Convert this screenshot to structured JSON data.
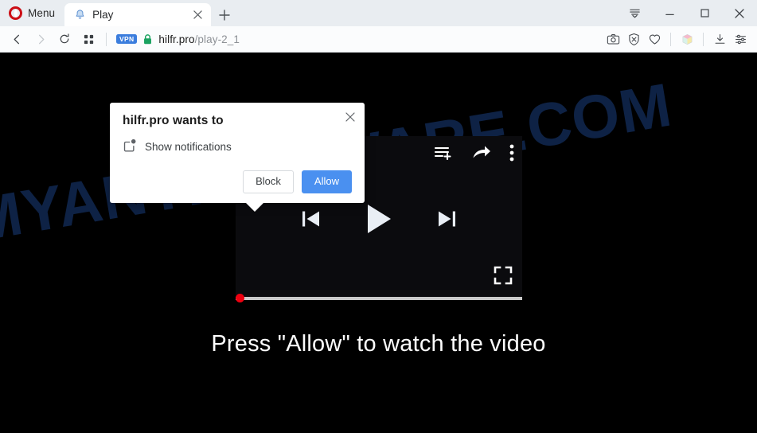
{
  "browser": {
    "menu_label": "Menu",
    "tab": {
      "title": "Play",
      "favicon": "bell-favicon",
      "close": "×"
    },
    "new_tab": "+",
    "window_controls": {
      "tab_list": "tab-list-icon",
      "minimize": "minimize-icon",
      "maximize": "maximize-icon",
      "close": "close-icon"
    },
    "nav": {
      "back": "back-arrow-icon",
      "forward": "forward-arrow-icon",
      "reload": "reload-icon",
      "workspaces": "grid-icon"
    },
    "address": {
      "vpn_badge": "VPN",
      "lock": "padlock-icon",
      "domain": "hilfr.pro",
      "path": "/play-2_1",
      "full_url": "hilfr.pro/play-2_1"
    },
    "toolbar_right": [
      {
        "name": "snapshot-icon",
        "label": "Snapshot"
      },
      {
        "name": "ad-block-icon",
        "label": "Ad blocker"
      },
      {
        "name": "heart-icon",
        "label": "Add to favorites"
      },
      {
        "name": "cube-icon",
        "label": "Extensions"
      },
      {
        "name": "downloads-icon",
        "label": "Downloads"
      },
      {
        "name": "easy-setup-icon",
        "label": "Easy setup"
      }
    ]
  },
  "permission_dialog": {
    "title": "hilfr.pro wants to",
    "permission_icon": "notifications-icon",
    "permission_label": "Show notifications",
    "block_label": "Block",
    "allow_label": "Allow",
    "close_label": "×"
  },
  "page": {
    "watermark": "MYANTISPYWARE.COM",
    "headline": "Press \"Allow\" to watch the video",
    "player": {
      "add_to_queue_icon": "add-to-queue-icon",
      "share_icon": "share-icon",
      "more_icon": "kebab-menu-icon",
      "previous_icon": "previous-track-icon",
      "play_icon": "play-icon",
      "next_icon": "next-track-icon",
      "fullscreen_icon": "fullscreen-icon",
      "progress_percent": 0
    }
  },
  "colors": {
    "accent_blue": "#4a90f0",
    "opera_red": "#cc0f16",
    "vpn_blue": "#3b7ddd",
    "lock_green": "#1aa260",
    "seek_red": "#ef0010",
    "watermark": "#0e2245",
    "page_bg": "#000000",
    "player_bg": "#0b0b0e"
  }
}
